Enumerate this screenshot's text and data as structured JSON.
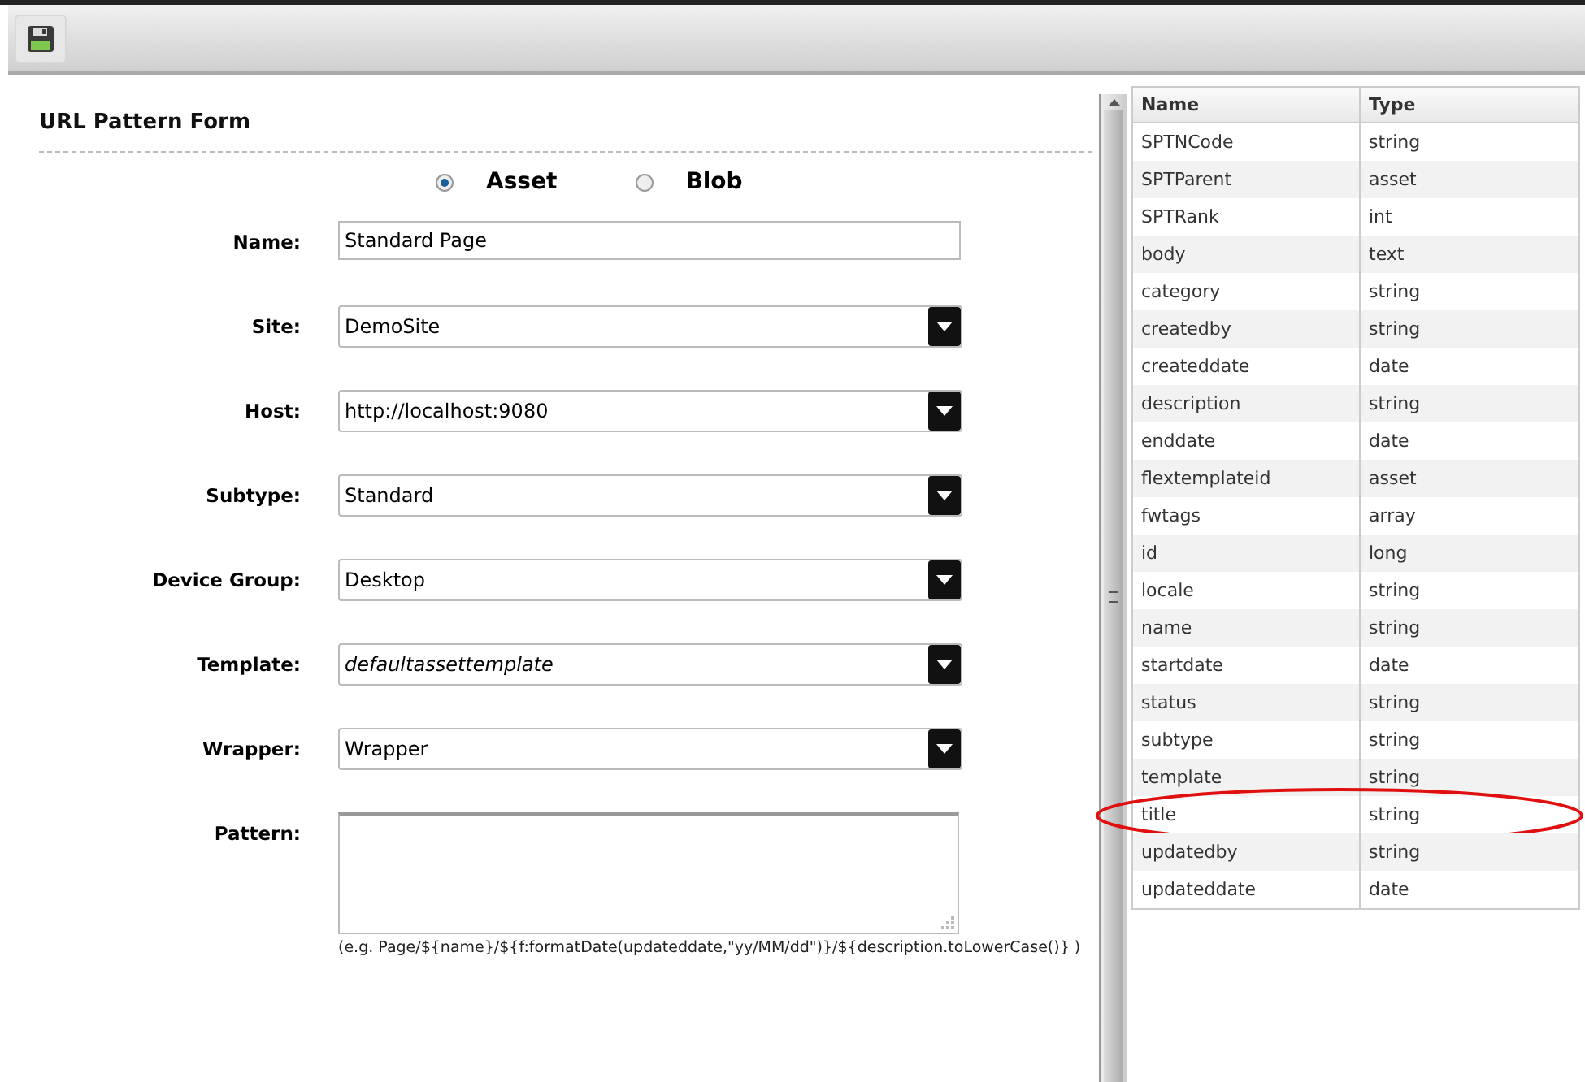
{
  "form": {
    "title": "URL Pattern Form",
    "radios": [
      {
        "label": "Asset",
        "selected": true
      },
      {
        "label": "Blob",
        "selected": false
      }
    ],
    "fields": [
      {
        "label": "Name:",
        "kind": "text",
        "value": "Standard Page",
        "italic": false
      },
      {
        "label": "Site:",
        "kind": "select",
        "value": "DemoSite",
        "italic": false
      },
      {
        "label": "Host:",
        "kind": "select",
        "value": "http://localhost:9080",
        "italic": false
      },
      {
        "label": "Subtype:",
        "kind": "select",
        "value": "Standard",
        "italic": false
      },
      {
        "label": "Device Group:",
        "kind": "select",
        "value": "Desktop",
        "italic": false
      },
      {
        "label": "Template:",
        "kind": "select",
        "value": "defaultassettemplate",
        "italic": true
      },
      {
        "label": "Wrapper:",
        "kind": "select",
        "value": "Wrapper",
        "italic": false
      },
      {
        "label": "Pattern:",
        "kind": "textarea"
      }
    ],
    "hint": "(e.g. Page/${name}/${f:formatDate(updateddate,\"yy/MM/dd\")}/${description.toLowerCase()} )"
  },
  "table": {
    "columns": [
      "Name",
      "Type"
    ],
    "rows": [
      {
        "name": "SPTNCode",
        "type": "string",
        "circled": false
      },
      {
        "name": "SPTParent",
        "type": "asset",
        "circled": false
      },
      {
        "name": "SPTRank",
        "type": "int",
        "circled": false
      },
      {
        "name": "body",
        "type": "text",
        "circled": false
      },
      {
        "name": "category",
        "type": "string",
        "circled": false
      },
      {
        "name": "createdby",
        "type": "string",
        "circled": false
      },
      {
        "name": "createddate",
        "type": "date",
        "circled": false
      },
      {
        "name": "description",
        "type": "string",
        "circled": false
      },
      {
        "name": "enddate",
        "type": "date",
        "circled": false
      },
      {
        "name": "flextemplateid",
        "type": "asset",
        "circled": false
      },
      {
        "name": "fwtags",
        "type": "array",
        "circled": false
      },
      {
        "name": "id",
        "type": "long",
        "circled": false
      },
      {
        "name": "locale",
        "type": "string",
        "circled": false
      },
      {
        "name": "name",
        "type": "string",
        "circled": false
      },
      {
        "name": "startdate",
        "type": "date",
        "circled": false
      },
      {
        "name": "status",
        "type": "string",
        "circled": false
      },
      {
        "name": "subtype",
        "type": "string",
        "circled": false
      },
      {
        "name": "template",
        "type": "string",
        "circled": false
      },
      {
        "name": "title",
        "type": "string",
        "circled": true
      },
      {
        "name": "updatedby",
        "type": "string",
        "circled": false
      },
      {
        "name": "updateddate",
        "type": "date",
        "circled": false
      }
    ]
  }
}
